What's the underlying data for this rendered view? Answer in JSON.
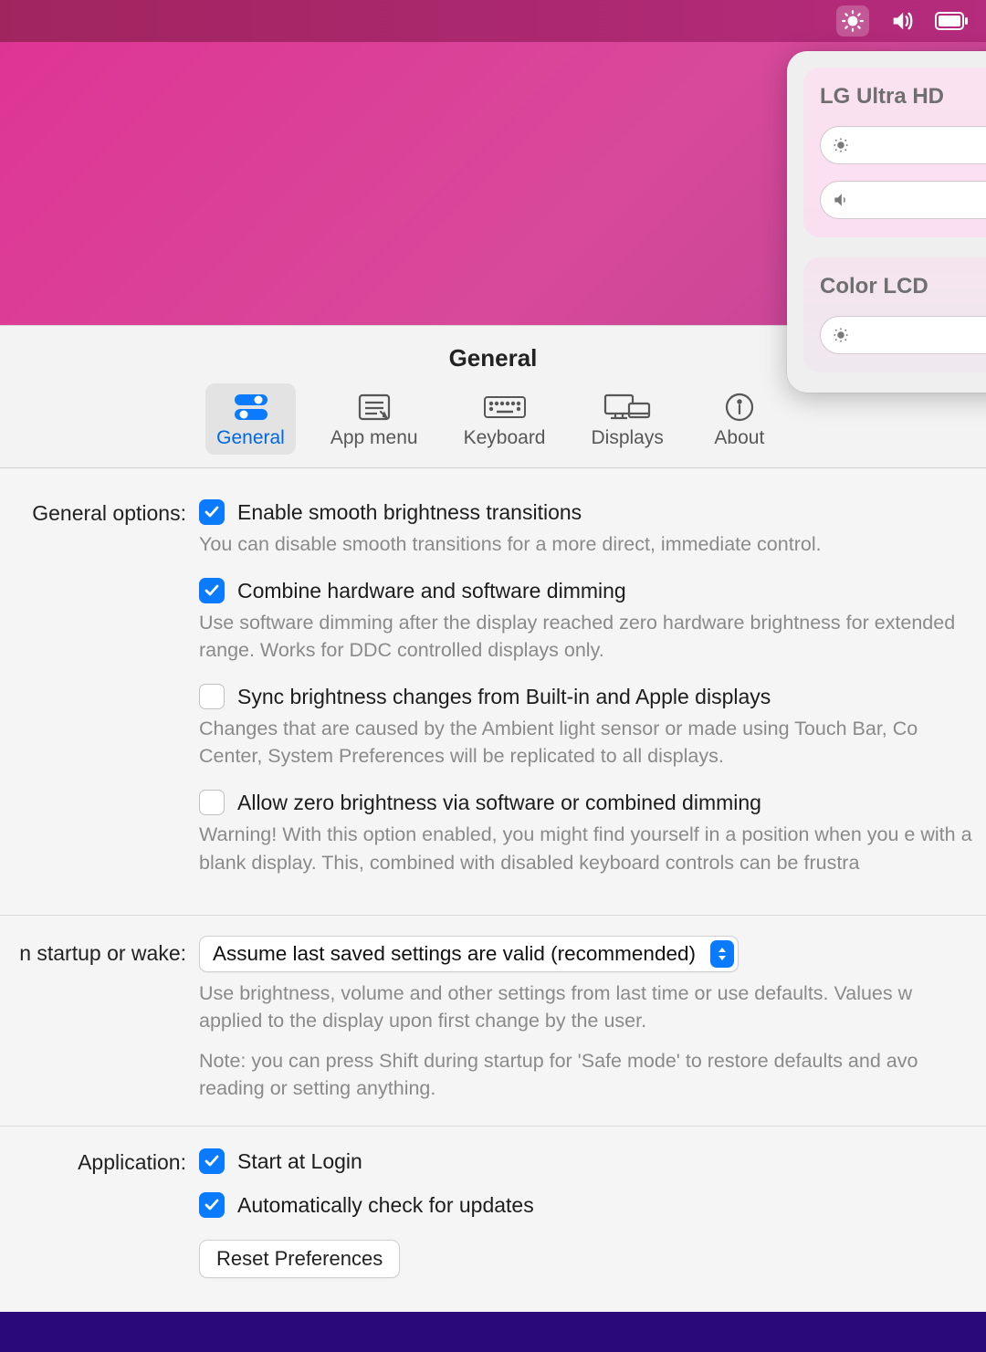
{
  "menubar": {
    "icons": [
      "brightness",
      "volume",
      "battery"
    ]
  },
  "panel": {
    "devices": [
      {
        "name": "LG Ultra HD",
        "sliders": [
          "brightness",
          "volume"
        ]
      },
      {
        "name": "Color LCD",
        "sliders": [
          "brightness"
        ]
      }
    ]
  },
  "window": {
    "title": "General",
    "tabs": [
      {
        "id": "general",
        "label": "General",
        "active": true
      },
      {
        "id": "appmenu",
        "label": "App menu"
      },
      {
        "id": "keyboard",
        "label": "Keyboard"
      },
      {
        "id": "displays",
        "label": "Displays"
      },
      {
        "id": "about",
        "label": "About"
      }
    ]
  },
  "sections": {
    "general": {
      "label": "General options:",
      "opts": [
        {
          "checked": true,
          "title": "Enable smooth brightness transitions",
          "help": "You can disable smooth transitions for a more direct, immediate control."
        },
        {
          "checked": true,
          "title": "Combine hardware and software dimming",
          "help": "Use software dimming after the display reached zero hardware brightness for extended range. Works for DDC controlled displays only."
        },
        {
          "checked": false,
          "title": "Sync brightness changes from Built-in and Apple displays",
          "help": "Changes that are caused by the Ambient light sensor or made using Touch Bar, Co Center, System Preferences will be replicated to all displays."
        },
        {
          "checked": false,
          "title": "Allow zero brightness via software or combined dimming",
          "help": "Warning! With this option enabled, you might find yourself in a position when you e with a blank display. This, combined with disabled keyboard controls can be frustra"
        }
      ]
    },
    "startup": {
      "label": "n startup or wake:",
      "select": "Assume last saved settings are valid (recommended)",
      "help1": "Use brightness, volume and other settings from last time or use defaults. Values w applied to the display upon first change by the user.",
      "help2": "Note: you can press Shift during startup for 'Safe mode' to restore defaults and avo reading or setting anything."
    },
    "application": {
      "label": "Application:",
      "opts": [
        {
          "checked": true,
          "title": "Start at Login"
        },
        {
          "checked": true,
          "title": "Automatically check for updates"
        }
      ],
      "reset": "Reset Preferences"
    }
  }
}
